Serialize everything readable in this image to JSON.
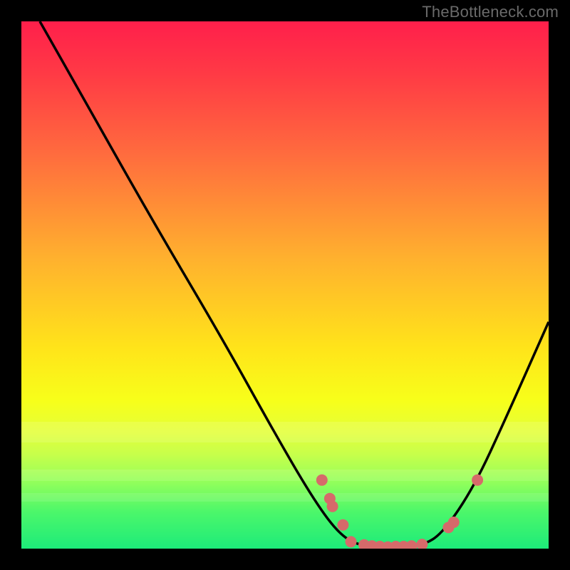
{
  "watermark": "TheBottleneck.com",
  "colors": {
    "frame": "#000000",
    "gradient_top": "#ff1f4b",
    "gradient_mid": "#ffe41a",
    "gradient_bottom": "#1deb7a",
    "curve": "#000000",
    "marker": "#d66a6a"
  },
  "chart_data": {
    "type": "line",
    "title": "",
    "xlabel": "",
    "ylabel": "",
    "xlim": [
      0,
      100
    ],
    "ylim": [
      0,
      100
    ],
    "grid": false,
    "curve_points": [
      {
        "x": 3.5,
        "y": 100
      },
      {
        "x": 12,
        "y": 85
      },
      {
        "x": 25,
        "y": 62
      },
      {
        "x": 38,
        "y": 40
      },
      {
        "x": 48,
        "y": 22
      },
      {
        "x": 55,
        "y": 10
      },
      {
        "x": 60,
        "y": 3
      },
      {
        "x": 64,
        "y": 0.5
      },
      {
        "x": 70,
        "y": 0.3
      },
      {
        "x": 76,
        "y": 0.5
      },
      {
        "x": 80,
        "y": 3
      },
      {
        "x": 86,
        "y": 12
      },
      {
        "x": 92,
        "y": 25
      },
      {
        "x": 100,
        "y": 43
      }
    ],
    "markers": [
      {
        "x": 57,
        "y": 13
      },
      {
        "x": 58.5,
        "y": 9.5
      },
      {
        "x": 59,
        "y": 8
      },
      {
        "x": 61,
        "y": 4.5
      },
      {
        "x": 62.5,
        "y": 1.3
      },
      {
        "x": 65,
        "y": 0.7
      },
      {
        "x": 66.5,
        "y": 0.5
      },
      {
        "x": 68,
        "y": 0.4
      },
      {
        "x": 69.5,
        "y": 0.3
      },
      {
        "x": 71,
        "y": 0.4
      },
      {
        "x": 72.5,
        "y": 0.4
      },
      {
        "x": 74,
        "y": 0.5
      },
      {
        "x": 76,
        "y": 0.8
      },
      {
        "x": 81,
        "y": 4
      },
      {
        "x": 82,
        "y": 5
      },
      {
        "x": 86.5,
        "y": 13
      }
    ]
  }
}
